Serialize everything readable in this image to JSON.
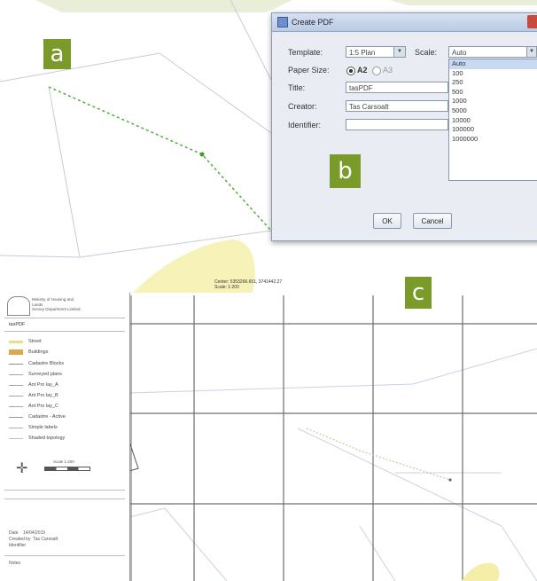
{
  "panels": {
    "a": "a",
    "b": "b",
    "c": "c"
  },
  "dialog": {
    "title": "Create PDF",
    "template_label": "Template:",
    "template_value": "1:5 Plan",
    "scale_label": "Scale:",
    "scale_value": "Auto",
    "paper_size_label": "Paper Size:",
    "paper_option_1": "A2",
    "paper_option_2": "A3",
    "title_label": "Title:",
    "title_value": "tasPDF",
    "creator_label": "Creator:",
    "creator_value": "Tas Carsoalt",
    "identifier_label": "Identifier:",
    "identifier_value": "",
    "ok_label": "OK",
    "cancel_label": "Cancel",
    "scale_options": [
      "Auto",
      "100",
      "250",
      "500",
      "1000",
      "5000",
      "10000",
      "100000",
      "1000000"
    ]
  },
  "map_c": {
    "center_text": "Center: 5353266.651, 3741442.27",
    "scale_text": "Scale: 1:200",
    "legend_title": "tasPDF",
    "legend_items": [
      {
        "label": "Street",
        "color": "#e8df8a"
      },
      {
        "label": "Buildings",
        "color": "#d9a94a"
      },
      {
        "label": "Cadastre Blocks",
        "color": "#7d8fa6"
      },
      {
        "label": "Surveyed plans",
        "color": "#9aa7b8"
      },
      {
        "label": "Ant Pro lay_A",
        "color": "#a4a4a4"
      },
      {
        "label": "Ant Pro lay_B",
        "color": "#a4a4a4"
      },
      {
        "label": "Ant Pro lay_C",
        "color": "#a4a4a4"
      },
      {
        "label": "Cadastre - Active",
        "color": "#8894a8"
      },
      {
        "label": "Simple labels",
        "color": "#b0b0b0"
      },
      {
        "label": "Shaded topology",
        "color": "#c0c0c0"
      }
    ],
    "org_line_1": "Ministry of Housing and",
    "org_line_2": "Lands",
    "org_line_3": "Survey Department Limited",
    "meta_rows": [
      {
        "k": "Date",
        "v": "14/04/2015"
      },
      {
        "k": "Created by",
        "v": "Tas Carsoalt"
      },
      {
        "k": "Identifier",
        "v": ""
      }
    ],
    "footer": "Notes",
    "scale_bar_label": "Scale 1:200"
  },
  "colors": {
    "accent_label_bg": "#7a9a2a",
    "grid_line": "#8c8c8c",
    "dashed_path": "#4caf3a",
    "highlight_yellow": "#f7f2b8"
  }
}
